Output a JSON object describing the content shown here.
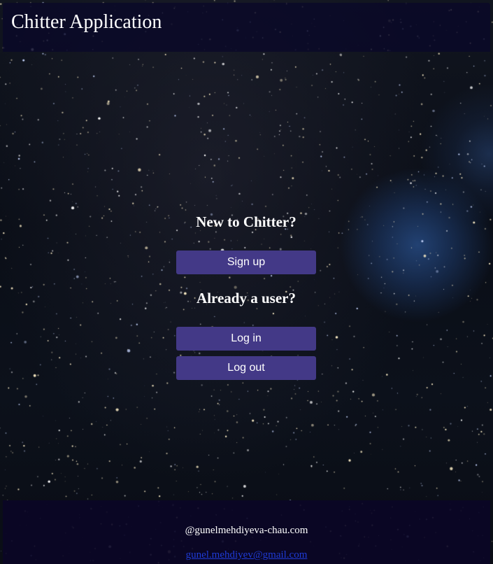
{
  "header": {
    "title": "Chitter Application"
  },
  "main": {
    "signup_heading": "New to Chitter?",
    "signup_button": "Sign up",
    "existing_heading": "Already a user?",
    "login_button": "Log in",
    "logout_button": "Log out"
  },
  "footer": {
    "handle": "@gunelmehdiyeva-chau.com",
    "email": "gunel.mehdiyev@gmail.com"
  },
  "colors": {
    "header_bg": "#0a0828",
    "button_bg": "#433987",
    "link": "#1f3bd6"
  }
}
